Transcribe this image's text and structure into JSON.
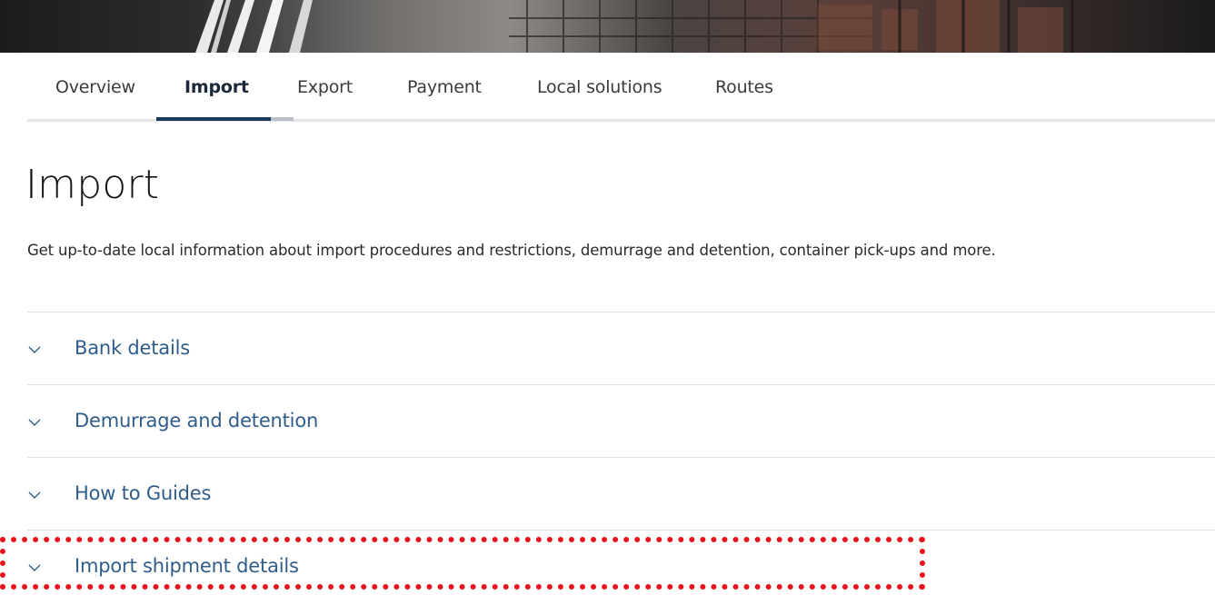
{
  "tabs": [
    {
      "label": "Overview",
      "active": false
    },
    {
      "label": "Import",
      "active": true
    },
    {
      "label": "Export",
      "active": false
    },
    {
      "label": "Payment",
      "active": false
    },
    {
      "label": "Local solutions",
      "active": false
    },
    {
      "label": "Routes",
      "active": false
    }
  ],
  "page": {
    "title": "Import",
    "intro": "Get up-to-date local information about import procedures and restrictions, demurrage and detention, container pick-ups and more."
  },
  "accordion": {
    "items": [
      {
        "label": "Bank details",
        "icon": "chevron-down-icon"
      },
      {
        "label": "Demurrage and detention",
        "icon": "chevron-down-icon"
      },
      {
        "label": "How to Guides",
        "icon": "chevron-down-icon"
      },
      {
        "label": "Import shipment details",
        "icon": "chevron-down-icon",
        "highlighted": true
      }
    ]
  },
  "colors": {
    "active_tab": "#1b2a3a",
    "accordion_link": "#2f5d8a",
    "highlight_border": "#e8141c",
    "divider": "#dcdfe3"
  }
}
